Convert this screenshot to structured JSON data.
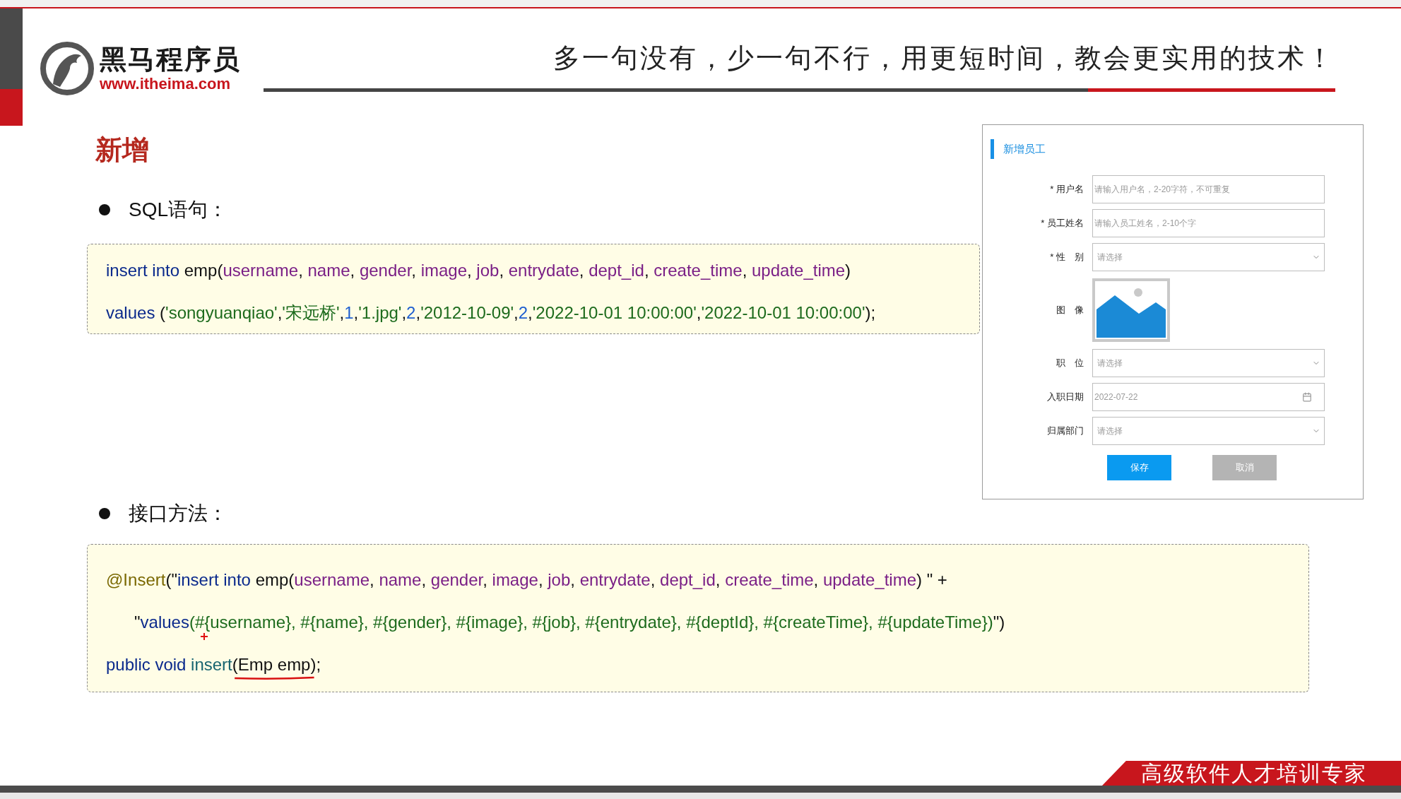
{
  "header": {
    "logo_name": "黑马程序员",
    "logo_url": "www.itheima.com",
    "slogan": "多一句没有，少一句不行，用更短时间，教会更实用的技术！"
  },
  "title": "新增",
  "sections": [
    {
      "bullet": "SQL语句：",
      "code": [
        [
          {
            "kind": "keyword",
            "text": "insert into"
          },
          {
            "kind": "plain",
            "text": " emp("
          },
          {
            "kind": "column",
            "text": "username"
          },
          {
            "kind": "plain",
            "text": ", "
          },
          {
            "kind": "column",
            "text": "name"
          },
          {
            "kind": "plain",
            "text": ", "
          },
          {
            "kind": "column",
            "text": "gender"
          },
          {
            "kind": "plain",
            "text": ", "
          },
          {
            "kind": "column",
            "text": "image"
          },
          {
            "kind": "plain",
            "text": ", "
          },
          {
            "kind": "column",
            "text": "job"
          },
          {
            "kind": "plain",
            "text": ", "
          },
          {
            "kind": "column",
            "text": "entrydate"
          },
          {
            "kind": "plain",
            "text": ", "
          },
          {
            "kind": "column",
            "text": "dept_id"
          },
          {
            "kind": "plain",
            "text": ", "
          },
          {
            "kind": "column",
            "text": "create_time"
          },
          {
            "kind": "plain",
            "text": ", "
          },
          {
            "kind": "column",
            "text": "update_time"
          },
          {
            "kind": "plain",
            "text": ")"
          }
        ],
        [
          {
            "kind": "keyword",
            "text": "values"
          },
          {
            "kind": "plain",
            "text": " ("
          },
          {
            "kind": "string",
            "text": "'songyuanqiao'"
          },
          {
            "kind": "plain",
            "text": ","
          },
          {
            "kind": "string",
            "text": "'宋远桥'"
          },
          {
            "kind": "plain",
            "text": ","
          },
          {
            "kind": "number",
            "text": "1"
          },
          {
            "kind": "plain",
            "text": ","
          },
          {
            "kind": "string",
            "text": "'1.jpg'"
          },
          {
            "kind": "plain",
            "text": ","
          },
          {
            "kind": "number",
            "text": "2"
          },
          {
            "kind": "plain",
            "text": ","
          },
          {
            "kind": "string",
            "text": "'2012-10-09'"
          },
          {
            "kind": "plain",
            "text": ","
          },
          {
            "kind": "number",
            "text": "2"
          },
          {
            "kind": "plain",
            "text": ","
          },
          {
            "kind": "string",
            "text": "'2022-10-01 10:00:00'"
          },
          {
            "kind": "plain",
            "text": ","
          },
          {
            "kind": "string",
            "text": "'2022-10-01 10:00:00'"
          },
          {
            "kind": "plain",
            "text": ");"
          }
        ]
      ]
    },
    {
      "bullet": "接口方法：",
      "code": [
        [
          {
            "kind": "annotation",
            "text": "@Insert"
          },
          {
            "kind": "plain",
            "text": "(\""
          },
          {
            "kind": "keyword",
            "text": "insert into"
          },
          {
            "kind": "plain",
            "text": " emp("
          },
          {
            "kind": "column",
            "text": "username"
          },
          {
            "kind": "plain",
            "text": ", "
          },
          {
            "kind": "column",
            "text": "name"
          },
          {
            "kind": "plain",
            "text": ", "
          },
          {
            "kind": "column",
            "text": "gender"
          },
          {
            "kind": "plain",
            "text": ", "
          },
          {
            "kind": "column",
            "text": "image"
          },
          {
            "kind": "plain",
            "text": ", "
          },
          {
            "kind": "column",
            "text": "job"
          },
          {
            "kind": "plain",
            "text": ", "
          },
          {
            "kind": "column",
            "text": "entrydate"
          },
          {
            "kind": "plain",
            "text": ", "
          },
          {
            "kind": "column",
            "text": "dept_id"
          },
          {
            "kind": "plain",
            "text": ", "
          },
          {
            "kind": "column",
            "text": "create_time"
          },
          {
            "kind": "plain",
            "text": ", "
          },
          {
            "kind": "column",
            "text": "update_time"
          },
          {
            "kind": "plain",
            "text": ") \" +"
          }
        ],
        [
          {
            "kind": "indent",
            "text": "\""
          },
          {
            "kind": "keyword",
            "text": "values"
          },
          {
            "kind": "string",
            "text": "(#"
          },
          {
            "kind": "string",
            "text": "{username}, #{name}, #{gender}, #{image}, #{job}, #{entrydate}, #{deptId}, #{createTime}, #{updateTime})",
            "plus_mark": true
          },
          {
            "kind": "plain",
            "text": "\")"
          }
        ],
        [
          {
            "kind": "keyword",
            "text": "public void "
          },
          {
            "kind": "method",
            "text": "insert"
          },
          {
            "kind": "plain",
            "text": "("
          },
          {
            "kind": "plain",
            "text": "Emp emp",
            "underline_mark": true
          },
          {
            "kind": "plain",
            "text": ");"
          }
        ]
      ]
    }
  ],
  "form": {
    "title": "新增员工",
    "fields": [
      {
        "kind": "text",
        "label": "* 用户名",
        "placeholder": "请输入用户名，2-20字符，不可重复"
      },
      {
        "kind": "text",
        "label": "* 员工姓名",
        "placeholder": "请输入员工姓名，2-10个字"
      },
      {
        "kind": "select",
        "label": "* 性　别",
        "placeholder": "请选择"
      },
      {
        "kind": "image",
        "label": "图　像"
      },
      {
        "kind": "select",
        "label": "职　位",
        "placeholder": "请选择"
      },
      {
        "kind": "date",
        "label": "入职日期",
        "placeholder": "2022-07-22"
      },
      {
        "kind": "select",
        "label": "归属部门",
        "placeholder": "请选择"
      }
    ],
    "buttons": [
      {
        "kind": "primary",
        "label": "保存"
      },
      {
        "kind": "disabled",
        "label": "取消"
      }
    ]
  },
  "footer": "高级软件人才培训专家"
}
